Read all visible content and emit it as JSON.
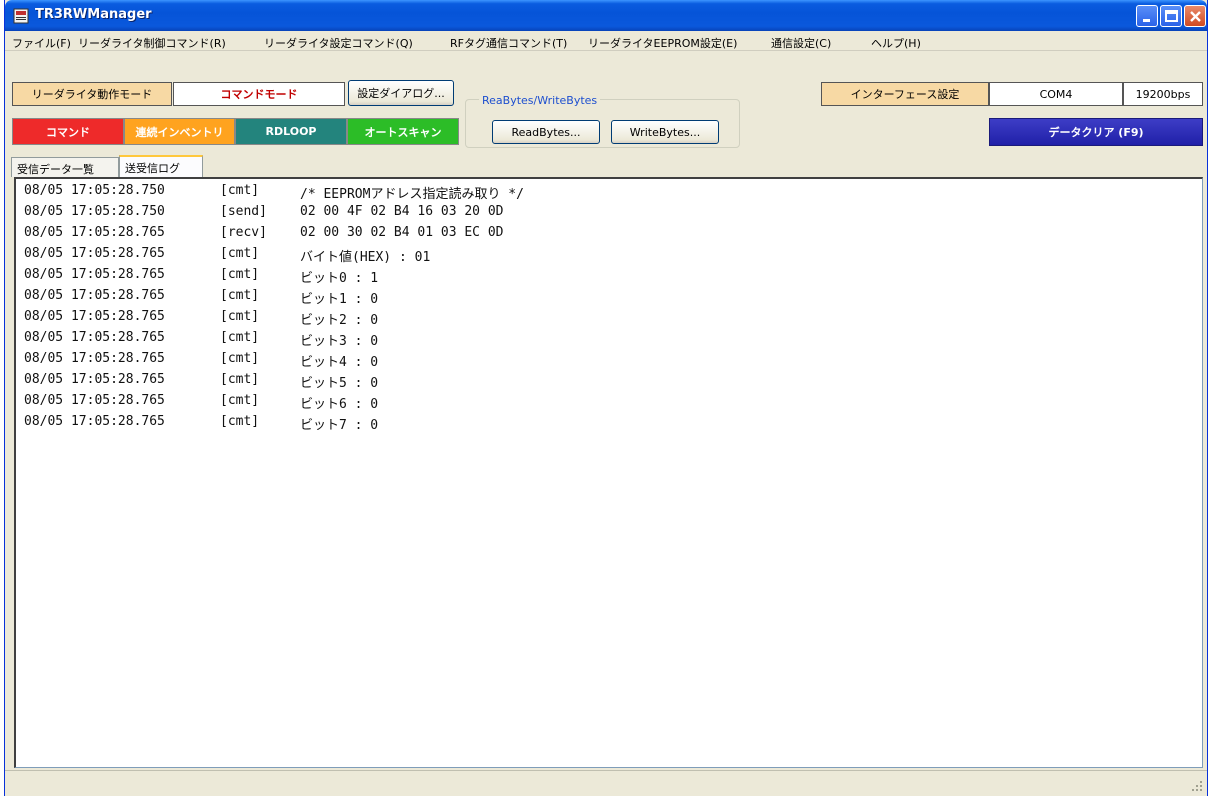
{
  "window": {
    "title": "TR3RWManager"
  },
  "menu": [
    "ファイル(F)",
    "リーダライタ制御コマンド(R)",
    "リーダライタ設定コマンド(Q)",
    "RFタグ通信コマンド(T)",
    "リーダライタEEPROM設定(E)",
    "通信設定(C)",
    "ヘルプ(H)"
  ],
  "toolbar": {
    "mode_label": "リーダライタ動作モード",
    "mode_value": "コマンドモード",
    "settings_dialog": "設定ダイアログ...",
    "commands": [
      "コマンド",
      "連続インベントリ",
      "RDLOOP",
      "オートスキャン"
    ],
    "group_title": "ReaBytes/WriteBytes",
    "read_bytes": "ReadBytes...",
    "write_bytes": "WriteBytes...",
    "interface_label": "インターフェース設定",
    "port": "COM4",
    "baud": "19200bps",
    "clear_data": "データクリア (F9)"
  },
  "tabs": [
    {
      "label": "受信データ一覧",
      "active": false
    },
    {
      "label": "送受信ログ",
      "active": true
    }
  ],
  "log": [
    {
      "time": "08/05 17:05:28.750",
      "kind": "[cmt]",
      "message": "/* EEPROMアドレス指定読み取り */"
    },
    {
      "time": "08/05 17:05:28.750",
      "kind": "[send]",
      "message": "02 00 4F 02 B4 16 03 20 0D"
    },
    {
      "time": "08/05 17:05:28.765",
      "kind": "[recv]",
      "message": "02 00 30 02 B4 01 03 EC 0D"
    },
    {
      "time": "08/05 17:05:28.765",
      "kind": "[cmt]",
      "message": "バイト値(HEX) : 01"
    },
    {
      "time": "08/05 17:05:28.765",
      "kind": "[cmt]",
      "message": "ビット0 : 1"
    },
    {
      "time": "08/05 17:05:28.765",
      "kind": "[cmt]",
      "message": "ビット1 : 0"
    },
    {
      "time": "08/05 17:05:28.765",
      "kind": "[cmt]",
      "message": "ビット2 : 0"
    },
    {
      "time": "08/05 17:05:28.765",
      "kind": "[cmt]",
      "message": "ビット3 : 0"
    },
    {
      "time": "08/05 17:05:28.765",
      "kind": "[cmt]",
      "message": "ビット4 : 0"
    },
    {
      "time": "08/05 17:05:28.765",
      "kind": "[cmt]",
      "message": "ビット5 : 0"
    },
    {
      "time": "08/05 17:05:28.765",
      "kind": "[cmt]",
      "message": "ビット6 : 0"
    },
    {
      "time": "08/05 17:05:28.765",
      "kind": "[cmt]",
      "message": "ビット7 : 0"
    }
  ],
  "icons": {
    "app": "app-icon",
    "minimize": "minimize-icon",
    "maximize": "maximize-icon",
    "close": "close-icon",
    "resize": "resize-grip-icon"
  }
}
